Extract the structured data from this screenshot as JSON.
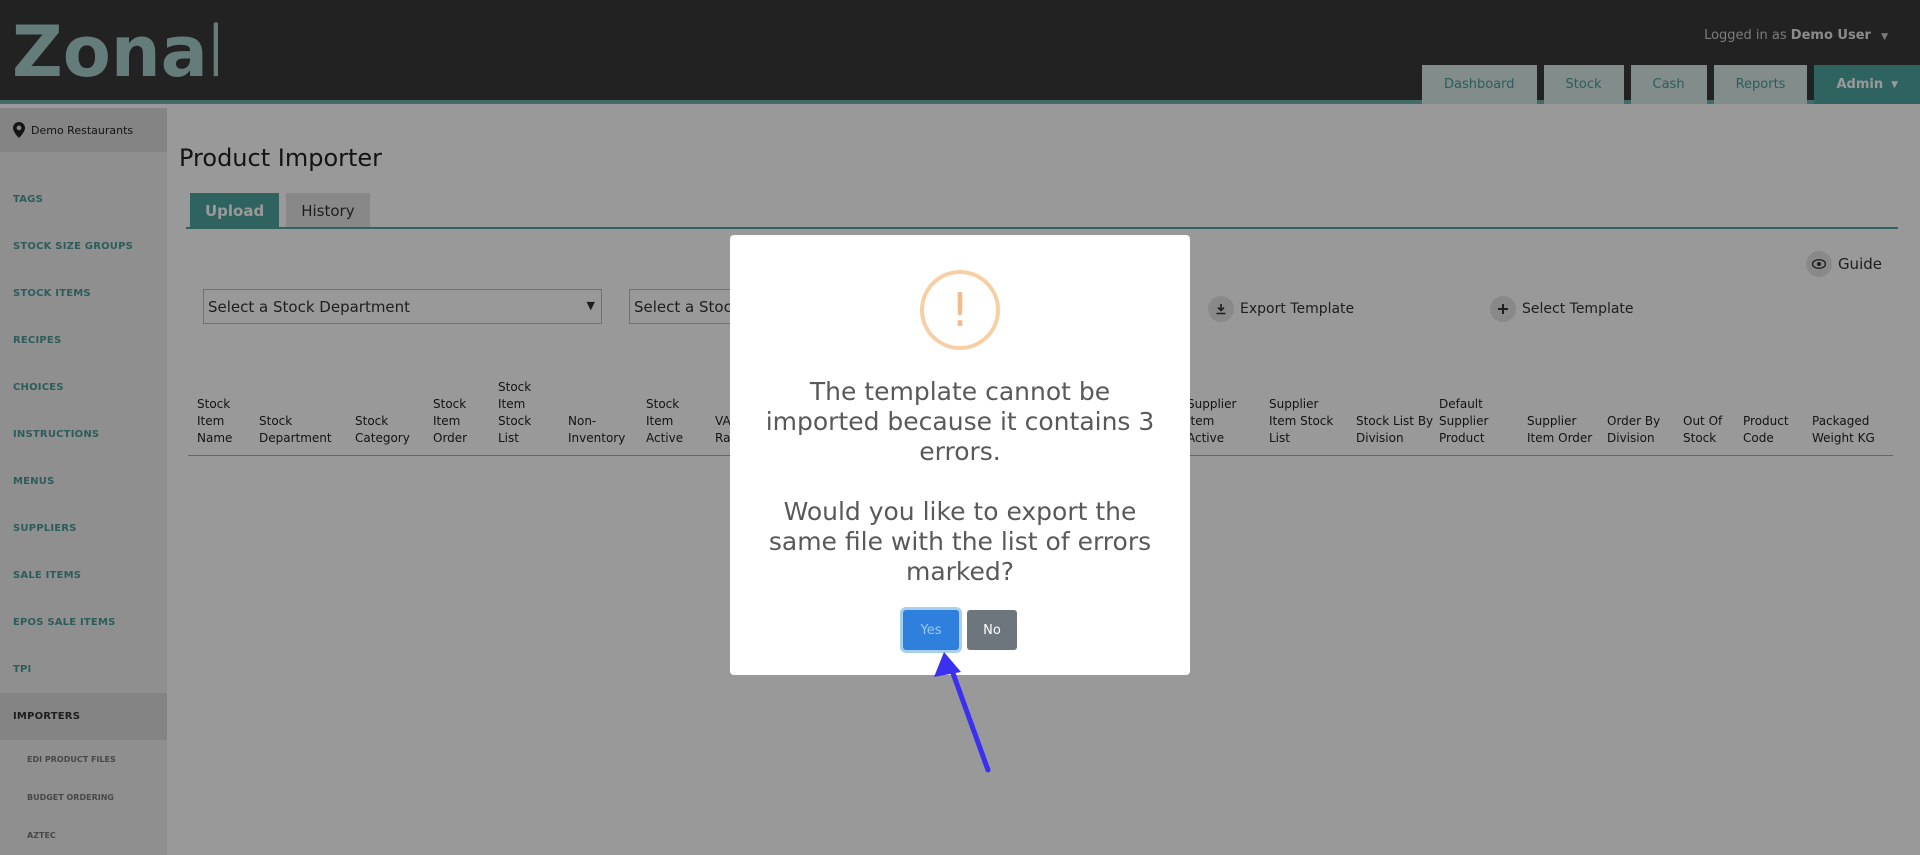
{
  "header": {
    "logo_text": "Zonal",
    "logged_prefix": "Logged in as",
    "user_name": "Demo User",
    "nav": [
      "Dashboard",
      "Stock",
      "Cash",
      "Reports",
      "Admin"
    ]
  },
  "sidebar": {
    "site_name": "Demo Restaurants",
    "items": [
      "TAGS",
      "STOCK SIZE GROUPS",
      "STOCK ITEMS",
      "RECIPES",
      "CHOICES",
      "INSTRUCTIONS",
      "MENUS",
      "SUPPLIERS",
      "SALE ITEMS",
      "EPOS SALE ITEMS",
      "TPI",
      "IMPORTERS"
    ],
    "subitems": [
      "EDI PRODUCT FILES",
      "BUDGET ORDERING",
      "AZTEC"
    ]
  },
  "main": {
    "title": "Product Importer",
    "tabs": [
      "Upload",
      "History"
    ],
    "guide_label": "Guide",
    "department_select": "Select a Stock Department",
    "second_select": "Select a Stock",
    "export_template": "Export Template",
    "select_template": "Select Template",
    "columns": [
      "Stock Item Name",
      "Stock Department",
      "Stock Category",
      "Stock Item Order",
      "Stock Item Stock List",
      "Non-Inventory",
      "Stock Item Active",
      "VA Ra",
      "Supplier Item Active",
      "Supplier Item Stock List",
      "Stock List By Division",
      "Default Supplier Product",
      "Supplier Item Order",
      "Order By Division",
      "Out Of Stock",
      "Product Code",
      "Packaged Weight KG"
    ]
  },
  "modal": {
    "icon": "!",
    "message_1": "The template cannot be imported because it contains 3 errors.",
    "message_2": "Would you like to export the same file with the list of errors marked?",
    "yes_label": "Yes",
    "no_label": "No"
  },
  "colors": {
    "header_bg": "#3a3a3a",
    "accent": "#4fa5a0",
    "warning": "#f6b98a",
    "yes_button": "#2f80dd",
    "no_button": "#6d757d",
    "arrow": "#3b30f0"
  },
  "icons": [
    "location-pin-icon",
    "eye-icon",
    "download-icon",
    "plus-icon",
    "warning-icon",
    "arrow-pointer-icon"
  ]
}
